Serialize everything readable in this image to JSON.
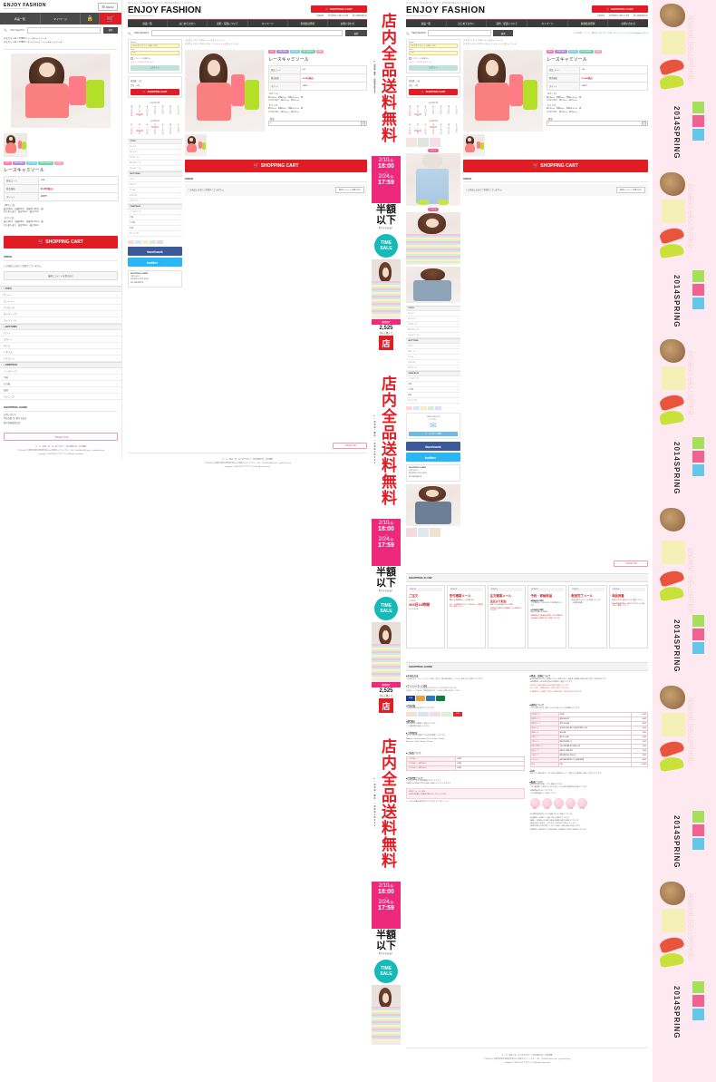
{
  "site": {
    "logo": "ENJOY FASHION",
    "tagline": "fashion is fun. there are a lot of it.",
    "topline": "当サイトは、デモ用のお買い物サイトです。実際の商品の販売はしておりません。",
    "menu_label": "MENU",
    "cart_button": "SHOPPING CART",
    "utility_links": [
      "・会員登録",
      "・特定商取引に関する法律",
      "・個人情報保護方針"
    ]
  },
  "nav": {
    "items": [
      "商品一覧",
      "はじめての方へ",
      "送料・配送について",
      "マイページ",
      "新規会員登録",
      "お問い合わせ"
    ]
  },
  "search": {
    "icon": "search-icon",
    "label": "ITEM SEARCH",
    "value": "",
    "placeholder": "",
    "button": "検索",
    "keyword_label": "HOT検索キーワード：",
    "keywords": [
      "新作",
      "コーディガン",
      "アウター",
      "ムートン",
      "ニーハイ",
      "ワンピ",
      "Ray-Ban",
      "レギンス"
    ]
  },
  "breadcrumb": {
    "line1": "デモサイト11 > TOPS > レースキャミソール",
    "line2": "デモサイト11 > TOPS > キャミソール > レースキャミソール"
  },
  "login": {
    "email_label": "E-mail",
    "email_value": "お試し用アカウント（自動入力済）",
    "pass_label": "Pass",
    "pass_value": "••••••",
    "remember": "このページを記憶する",
    "forgot": "パスワードを忘れた方はこちら",
    "button": "ログイン"
  },
  "cart_box": {
    "items_label": "商品数：",
    "items_value": "0点",
    "total_label": "合計",
    "total_value": "0円",
    "button": "SHOPPING CART"
  },
  "calendars": [
    {
      "title": "2013年12月",
      "weekdays": [
        "日",
        "月",
        "火",
        "水",
        "木",
        "金",
        "土"
      ],
      "weeks": [
        [
          "1",
          "2",
          "3",
          "4",
          "5",
          "6",
          "7"
        ],
        [
          "8",
          "9",
          "10",
          "11",
          "12",
          "13",
          "14"
        ],
        [
          "15",
          "16",
          "17",
          "18",
          "19",
          "20",
          "21"
        ],
        [
          "22",
          "23",
          "24",
          "25",
          "26",
          "27",
          "28"
        ],
        [
          "29",
          "30",
          "31",
          "",
          "",
          "",
          ""
        ]
      ],
      "marked": [
        "23"
      ]
    },
    {
      "title": "2014年1月",
      "weekdays": [
        "日",
        "月",
        "火",
        "水",
        "木",
        "金",
        "土"
      ],
      "weeks": [
        [
          "",
          "",
          "",
          "1",
          "2",
          "3",
          "4"
        ],
        [
          "5",
          "6",
          "7",
          "8",
          "9",
          "10",
          "11"
        ],
        [
          "12",
          "13",
          "14",
          "15",
          "16",
          "17",
          "18"
        ],
        [
          "19",
          "20",
          "21",
          "22",
          "23",
          "24",
          "25"
        ],
        [
          "26",
          "27",
          "28",
          "29",
          "30",
          "31",
          ""
        ]
      ],
      "marked": [
        "1",
        "13"
      ]
    }
  ],
  "product": {
    "badges": [
      {
        "text": "NEW",
        "color": "#ff7aa8"
      },
      {
        "text": "TIME SALE",
        "color": "#b58be0"
      },
      {
        "text": "PICK UP",
        "color": "#7fd1e8"
      },
      {
        "text": "RECOMMEND",
        "color": "#6fd6a8"
      },
      {
        "text": "LIMIT",
        "color": "#f5a3c2"
      }
    ],
    "title": "レースキャミソール",
    "table": [
      {
        "key": "商品コード",
        "value": "t-01"
      },
      {
        "key": "販売価格",
        "value": "¥1,980(税込)",
        "accent": true
      },
      {
        "key": "ポイント",
        "value": "198PT"
      }
    ],
    "spec_m_title": "【Mサイズ】",
    "spec_m_lines": [
      "着丈60cm　肩幅32cm　身幅34~45cm　裾",
      "から折り返り　袖丈54cm　袖口37cm"
    ],
    "spec_l_title": "【Lサイズ】",
    "spec_l_lines": [
      "着丈62cm　肩幅33cm　身幅36~47cm　裾",
      "から折り返り　袖丈56cm　袖口39cm"
    ],
    "qty_label": "・数量",
    "qty_value": "1",
    "cart_button": "SHOPPING CART",
    "color_label": "Color"
  },
  "voice": {
    "heading": "VOICE",
    "text": "この商品にはまだご感想がございません。",
    "button": "最初にコメントを書き込む"
  },
  "categories": [
    {
      "group": "TOPS",
      "items": [
        "Tシャツ",
        "カットソー",
        "ワンピース",
        "タンクトップ",
        "キャミソール"
      ]
    },
    {
      "group": "BOTTOMS",
      "items": [
        "パンツ",
        "スカート",
        "デニム",
        "レギンス",
        "ペチコート"
      ]
    },
    {
      "group": "ONEPIECE",
      "items": [
        "ノースリーブ",
        "半袖",
        "七分袖",
        "長袖",
        "チュニック"
      ]
    }
  ],
  "social": {
    "facebook": "facebook",
    "twitter": "twitter"
  },
  "shopping_guide": {
    "heading": "SHOPPING GUIDE",
    "links": [
      "お問い合わせ",
      "特定商取引に関する表記",
      "個人情報保護方針"
    ]
  },
  "shopping_flow": {
    "heading": "SHOPPING FLOW",
    "steps": [
      {
        "no": "STEP01",
        "title": "ご注文",
        "body_head": "ご注文は",
        "body_big": "365日24時間",
        "body_tail": "いつでもOK!"
      },
      {
        "no": "STEP02",
        "title": "受付確認メール",
        "body": "弊社から自動配信メールが届きます。",
        "note": "※メール受信設定をされている方はメール受信設定をご確認ください。"
      },
      {
        "no": "STEP03",
        "title": "注文確認メール",
        "body_big": "当店より配信",
        "body": "内容でのお支払金額などのご案内",
        "note": "※在庫切れの場合はご連絡差し上げる場合がございます。"
      },
      {
        "no": "STEP04",
        "title": "予約・即納商品",
        "b1": "■即納商品の場合",
        "b1t": "ご注文確認メールのお日以より順次発送いたします。",
        "b2": "■予約商品の場合",
        "b2t": "商品の入荷後、順次発送。",
        "note": "※即納商品と予約商品を同時にご注文の場合は、予約商品の入荷後まとめて発送となります。"
      },
      {
        "no": "STEP05",
        "title": "配送完了メール",
        "body": "商品が発送されましたらご案内いたします。（伝票番号記載）"
      },
      {
        "no": "STEP06",
        "title": "商品到着",
        "body": "商品がお手元に届きましたらご確認ください。",
        "note": "※商品到着後不良品・誤品がございましたら7日以内にご連絡ください。"
      }
    ]
  },
  "guide": {
    "heading": "SHOPPING GUIDE",
    "left_col": [
      {
        "title": "■お支払方法",
        "lines": [
          "お支払方法は、クレジットカード決済、代引き、銀行振込前払い、コンビニ後払いをご利用いただけます。"
        ]
      },
      {
        "title": "●クレジットカード決済",
        "lines": [
          "クレジットカードでのお支払いは以下のカードがご利用いただけます。",
          "分割払い・リボ払いをご希望の場合はカード会社へお問い合わせください。"
        ]
      },
      {
        "title": "●代金引換",
        "lines": [
          "ご利用可能額は30万円までとなります。"
        ]
      },
      {
        "title": "●銀行振込",
        "lines": [
          "振込手数料はお客様のご負担となります。",
          "ご入金確認後の発送となります。"
        ]
      },
      {
        "title": "■ご使用環境",
        "lines": [
          "当サイトは以下の環境でのご利用を推奨しております。",
          "Windows : Internet Explorer 9以上 / Firefox / Chrome",
          "Macintosh : Safari / Firefox / Chrome"
        ]
      },
      {
        "title": "■営業時間について",
        "lines": [
          "ネットでのご注文は24時間受け付けております。",
          "お電話でのお問合せは平日10時〜18時とさせていただきます。",
          "定休日：土・日・祝日",
          "※定休日前後はお時間を頂戴することがございます。",
          "メールのお返事は翌営業日となりますのでご了承ください。"
        ]
      }
    ],
    "right_col": [
      {
        "title": "■商品・交換について",
        "lines": [
          "商品到着後7日以内にご連絡いただいた場合に限り、未使用・未開封の商品に限り返品・交換を承ります。",
          "お客様都合による返品の送料はお客様のご負担となります。",
          "※不良品・誤品の場合は当店が送料を負担いたします。",
          "※セール品・下着類は返品・交換をお受けできません。",
          "※お客様のもとで破損・汚損した商品は返品・交換をお受けできません。"
        ]
      },
      {
        "title": "■送料について",
        "lines": [
          "ご注文金額2,525円（税込）以上のお買い上げで送料無料となります。"
        ]
      }
    ],
    "ship_heading": "■送料について",
    "ship_table": [
      {
        "area": "北海道エリア",
        "pref": "北海道",
        "fee": "1,100円"
      },
      {
        "area": "北東北エリア",
        "pref": "青森 秋田 岩手",
        "fee": "900円"
      },
      {
        "area": "南東北エリア",
        "pref": "宮城 山形 福島",
        "fee": "800円"
      },
      {
        "area": "関東エリア",
        "pref": "茨城 栃木 群馬 埼玉 千葉 東京 神奈川 山梨",
        "fee": "700円"
      },
      {
        "area": "信越エリア",
        "pref": "新潟 長野",
        "fee": "700円"
      },
      {
        "area": "北陸エリア",
        "pref": "富山 石川 福井",
        "fee": "700円"
      },
      {
        "area": "中部エリア",
        "pref": "静岡 愛知 岐阜 三重",
        "fee": "700円"
      },
      {
        "area": "関西・近畿エリア",
        "pref": "大阪 京都 滋賀 奈良 和歌山 兵庫",
        "fee": "700円"
      },
      {
        "area": "四国エリア",
        "pref": "徳島 香川 愛媛 高知",
        "fee": "700円"
      },
      {
        "area": "中国エリア",
        "pref": "鳥取 島根 岡山 広島 山口",
        "fee": "700円"
      },
      {
        "area": "九州エリア",
        "pref": "福岡 佐賀 長崎 熊本 大分 宮崎 鹿児島",
        "fee": "800円"
      },
      {
        "area": "沖縄",
        "pref": "沖縄",
        "fee": "1,500円"
      }
    ],
    "ship_note_title": "■送料",
    "ship_note": "当店では、商品代金と、それ以外の必要料金として、送料および消費税（税込）を頂いております。",
    "delivery_title": "■配送について",
    "delivery_lines": [
      "配送会社は佐川急便・ヤマト運輸となります。",
      "ご注文確認後、午前中のご注文は当日、それ以降は翌営業日の出荷となります。",
      "※時間帯指定も承っております。",
      "ご注文確認画面にてご指定ください。"
    ],
    "time_slots": [
      "午前中",
      "12-14時",
      "14-16時",
      "16-18時",
      "18-21時"
    ]
  },
  "footer": {
    "links": [
      "ホーム",
      "商品一覧",
      "はじめての方へ",
      "特定商取引法",
      "会社概要"
    ],
    "address": "〒530-0047 大阪府大阪市北区西天満1-4-4 竜美ビルディング7F　TEL：06-0000-0000  mail：yourinfo@xx.jp",
    "copyright": "Copyright © 2000-2013 デモサイト11 All rights reserved.",
    "pagetop": "PAGE TOP"
  },
  "promo": {
    "free_ship": "店内全品送料無料",
    "free_sub": "※一部商品・離島・一部地域を除きます。",
    "date_from": "2/10",
    "date_from_day": "(月)",
    "time_from": "18:00",
    "sep": "↓",
    "date_to": "2/24",
    "date_to_day": "(月)",
    "time_to": "17:59",
    "half": "半額以下",
    "half_sub": "のアイテムも！",
    "time_sale": "TIME SALE",
    "limited": "期間限定",
    "amount": "2,525",
    "amount_sub": "円以上購入で"
  },
  "season": {
    "label": "SEASON COLLECTION",
    "year": "2014SPRING"
  }
}
